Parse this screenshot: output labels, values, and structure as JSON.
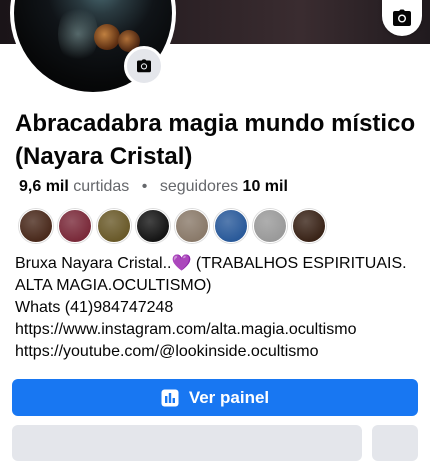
{
  "profile": {
    "name": "Abracadabra magia mundo místico (Nayara Cristal)",
    "stats": {
      "likes_count": "9,6 mil",
      "likes_label": "curtidas",
      "separator": "•",
      "followers_label": "seguidores",
      "followers_count": "10 mil"
    },
    "bio": {
      "line1_text": "Bruxa Nayara Cristal..",
      "line1_emoji": "💜",
      "line1_rest": " (TRABALHOS ESPIRITUAIS.",
      "line2": "ALTA MAGIA.OCULTISMO)",
      "line3": "Whats (41)984747248",
      "line4": "https://www.instagram.com/alta.magia.ocultismo",
      "line5": "https://youtube.com/@lookinside.ocultismo"
    },
    "follower_avatar_colors": [
      "#4a2a1c",
      "#7a2a3a",
      "#6a5a2a",
      "#151515",
      "#8a7a6a",
      "#2a5a9a",
      "#9a9a9a",
      "#3a2418"
    ]
  },
  "actions": {
    "view_panel_label": "Ver painel"
  },
  "colors": {
    "primary": "#1877f2",
    "secondary_text": "#65676b"
  },
  "icons": {
    "cover_camera": "camera-icon",
    "avatar_camera": "camera-icon",
    "panel": "bar-chart-icon"
  }
}
